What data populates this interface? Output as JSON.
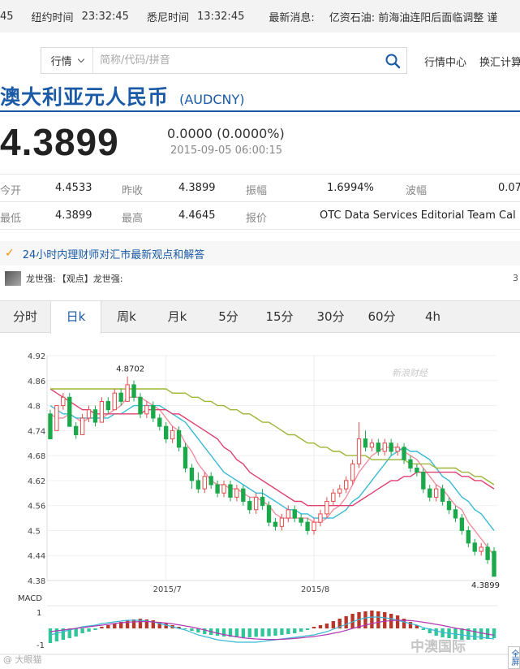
{
  "ticker": {
    "lead": "45",
    "ny_label": "纽约时间",
    "ny_time": "23:32:45",
    "sy_label": "悉尼时间",
    "sy_time": "13:32:45",
    "news_label": "最新消息:",
    "news_text": "亿资石油: 前海油连阳后面临调整 谨"
  },
  "search": {
    "market": "行情",
    "placeholder": "简称/代码/拼音"
  },
  "nav": [
    "行情中心",
    "换汇计算"
  ],
  "header": {
    "title": "澳大利亚元人民币",
    "code": "(AUDCNY)"
  },
  "quote": {
    "price": "4.3899",
    "change": "0.0000 (0.0000%)",
    "time": "2015-09-05 06:00:15",
    "rows": [
      [
        {
          "label": "今开",
          "value": "4.4533"
        },
        {
          "label": "昨收",
          "value": "4.3899"
        },
        {
          "label": "振幅",
          "value": "1.6994%"
        },
        {
          "label": "波幅",
          "value": "0.07"
        }
      ],
      [
        {
          "label": "最低",
          "value": "4.3899"
        },
        {
          "label": "最高",
          "value": "4.4645"
        },
        {
          "label": "报价",
          "value": "OTC Data Services Editorial Team Cal"
        }
      ]
    ]
  },
  "advisor": {
    "headline": "24小时内理财师对汇市最新观点和解答",
    "author": "龙世强:",
    "post": "【观点】龙世强:",
    "count": "3"
  },
  "tabs": [
    "分时",
    "日k",
    "周k",
    "月k",
    "5分",
    "15分",
    "30分",
    "60分",
    "4h"
  ],
  "active_tab": 1,
  "brand_watermark": "新浪财经",
  "watermarks": {
    "left": "@ 大眼猫",
    "right": "中澳国际"
  },
  "fullscreen": "全屏",
  "chart_data": {
    "type": "candlestick",
    "ylim": [
      4.38,
      4.92
    ],
    "yticks": [
      4.92,
      4.86,
      4.8,
      4.74,
      4.68,
      4.62,
      4.56,
      4.5,
      4.44,
      4.38
    ],
    "xticks": [
      {
        "label": "2015/7",
        "index": 18
      },
      {
        "label": "2015/8",
        "index": 41
      }
    ],
    "annotations": [
      {
        "label": "4.8702",
        "index": 12
      },
      {
        "label": "4.3899",
        "index": 69
      }
    ],
    "candles": [
      [
        4.78,
        4.72,
        4.79,
        4.72
      ],
      [
        4.74,
        4.8,
        4.8,
        4.74
      ],
      [
        4.8,
        4.82,
        4.83,
        4.79
      ],
      [
        4.82,
        4.75,
        4.83,
        4.75
      ],
      [
        4.75,
        4.73,
        4.76,
        4.72
      ],
      [
        4.73,
        4.77,
        4.78,
        4.73
      ],
      [
        4.77,
        4.79,
        4.8,
        4.76
      ],
      [
        4.79,
        4.76,
        4.8,
        4.75
      ],
      [
        4.76,
        4.81,
        4.82,
        4.76
      ],
      [
        4.81,
        4.79,
        4.82,
        4.78
      ],
      [
        4.79,
        4.83,
        4.84,
        4.79
      ],
      [
        4.83,
        4.81,
        4.84,
        4.8
      ],
      [
        4.81,
        4.85,
        4.87,
        4.81
      ],
      [
        4.85,
        4.82,
        4.86,
        4.81
      ],
      [
        4.82,
        4.78,
        4.83,
        4.77
      ],
      [
        4.78,
        4.8,
        4.81,
        4.77
      ],
      [
        4.8,
        4.77,
        4.81,
        4.76
      ],
      [
        4.77,
        4.75,
        4.78,
        4.74
      ],
      [
        4.75,
        4.72,
        4.76,
        4.71
      ],
      [
        4.72,
        4.74,
        4.75,
        4.71
      ],
      [
        4.74,
        4.7,
        4.75,
        4.69
      ],
      [
        4.7,
        4.65,
        4.71,
        4.64
      ],
      [
        4.65,
        4.62,
        4.66,
        4.6
      ],
      [
        4.62,
        4.6,
        4.64,
        4.59
      ],
      [
        4.6,
        4.63,
        4.64,
        4.59
      ],
      [
        4.63,
        4.61,
        4.64,
        4.6
      ],
      [
        4.61,
        4.59,
        4.62,
        4.58
      ],
      [
        4.59,
        4.61,
        4.62,
        4.58
      ],
      [
        4.61,
        4.58,
        4.62,
        4.57
      ],
      [
        4.58,
        4.6,
        4.61,
        4.57
      ],
      [
        4.6,
        4.57,
        4.61,
        4.56
      ],
      [
        4.57,
        4.55,
        4.58,
        4.54
      ],
      [
        4.55,
        4.58,
        4.59,
        4.54
      ],
      [
        4.58,
        4.56,
        4.6,
        4.55
      ],
      [
        4.56,
        4.52,
        4.57,
        4.51
      ],
      [
        4.52,
        4.51,
        4.53,
        4.5
      ],
      [
        4.51,
        4.53,
        4.54,
        4.5
      ],
      [
        4.53,
        4.55,
        4.56,
        4.52
      ],
      [
        4.55,
        4.53,
        4.56,
        4.52
      ],
      [
        4.53,
        4.52,
        4.54,
        4.51
      ],
      [
        4.52,
        4.5,
        4.53,
        4.49
      ],
      [
        4.5,
        4.52,
        4.53,
        4.49
      ],
      [
        4.52,
        4.54,
        4.55,
        4.51
      ],
      [
        4.54,
        4.57,
        4.58,
        4.53
      ],
      [
        4.57,
        4.59,
        4.6,
        4.56
      ],
      [
        4.59,
        4.6,
        4.61,
        4.58
      ],
      [
        4.6,
        4.62,
        4.63,
        4.59
      ],
      [
        4.62,
        4.66,
        4.67,
        4.61
      ],
      [
        4.66,
        4.72,
        4.76,
        4.65
      ],
      [
        4.72,
        4.7,
        4.74,
        4.69
      ],
      [
        4.7,
        4.71,
        4.72,
        4.69
      ],
      [
        4.71,
        4.69,
        4.72,
        4.68
      ],
      [
        4.69,
        4.71,
        4.72,
        4.68
      ],
      [
        4.71,
        4.69,
        4.72,
        4.68
      ],
      [
        4.69,
        4.7,
        4.71,
        4.68
      ],
      [
        4.7,
        4.67,
        4.71,
        4.66
      ],
      [
        4.67,
        4.65,
        4.68,
        4.64
      ],
      [
        4.65,
        4.64,
        4.66,
        4.63
      ],
      [
        4.64,
        4.6,
        4.65,
        4.59
      ],
      [
        4.6,
        4.58,
        4.61,
        4.57
      ],
      [
        4.58,
        4.6,
        4.61,
        4.57
      ],
      [
        4.6,
        4.57,
        4.61,
        4.56
      ],
      [
        4.57,
        4.55,
        4.58,
        4.54
      ],
      [
        4.55,
        4.53,
        4.56,
        4.52
      ],
      [
        4.53,
        4.5,
        4.54,
        4.49
      ],
      [
        4.5,
        4.47,
        4.51,
        4.46
      ],
      [
        4.47,
        4.45,
        4.48,
        4.44
      ],
      [
        4.45,
        4.46,
        4.47,
        4.44
      ],
      [
        4.46,
        4.43,
        4.47,
        4.42
      ],
      [
        4.45,
        4.39,
        4.46,
        4.39
      ]
    ],
    "ma": [
      {
        "name": "MA5",
        "color": "#ef8fa0",
        "values": [
          4.78,
          4.77,
          4.77,
          4.78,
          4.77,
          4.76,
          4.77,
          4.77,
          4.77,
          4.78,
          4.79,
          4.8,
          4.82,
          4.82,
          4.82,
          4.81,
          4.8,
          4.79,
          4.77,
          4.75,
          4.74,
          4.71,
          4.69,
          4.66,
          4.64,
          4.62,
          4.61,
          4.61,
          4.6,
          4.6,
          4.59,
          4.58,
          4.58,
          4.57,
          4.56,
          4.54,
          4.53,
          4.53,
          4.53,
          4.53,
          4.53,
          4.52,
          4.52,
          4.53,
          4.55,
          4.56,
          4.58,
          4.61,
          4.64,
          4.66,
          4.68,
          4.69,
          4.7,
          4.7,
          4.7,
          4.69,
          4.68,
          4.67,
          4.65,
          4.63,
          4.61,
          4.6,
          4.58,
          4.56,
          4.55,
          4.52,
          4.5,
          4.48,
          4.46,
          4.44
        ]
      },
      {
        "name": "MA10",
        "color": "#39b9d6",
        "values": [
          4.8,
          4.79,
          4.78,
          4.78,
          4.77,
          4.77,
          4.77,
          4.77,
          4.77,
          4.77,
          4.78,
          4.78,
          4.79,
          4.8,
          4.8,
          4.8,
          4.8,
          4.8,
          4.79,
          4.78,
          4.77,
          4.76,
          4.74,
          4.72,
          4.7,
          4.68,
          4.66,
          4.64,
          4.63,
          4.62,
          4.61,
          4.6,
          4.59,
          4.59,
          4.58,
          4.57,
          4.56,
          4.55,
          4.55,
          4.54,
          4.54,
          4.53,
          4.53,
          4.53,
          4.53,
          4.54,
          4.55,
          4.57,
          4.58,
          4.6,
          4.62,
          4.64,
          4.66,
          4.68,
          4.69,
          4.7,
          4.69,
          4.69,
          4.68,
          4.67,
          4.65,
          4.63,
          4.62,
          4.6,
          4.58,
          4.57,
          4.55,
          4.54,
          4.52,
          4.5
        ]
      },
      {
        "name": "MA20",
        "color": "#de4070",
        "values": [
          4.84,
          4.83,
          4.82,
          4.81,
          4.8,
          4.79,
          4.79,
          4.78,
          4.78,
          4.78,
          4.78,
          4.78,
          4.78,
          4.78,
          4.78,
          4.79,
          4.79,
          4.79,
          4.79,
          4.78,
          4.78,
          4.77,
          4.76,
          4.75,
          4.74,
          4.73,
          4.72,
          4.7,
          4.69,
          4.67,
          4.66,
          4.64,
          4.63,
          4.62,
          4.61,
          4.6,
          4.59,
          4.58,
          4.57,
          4.57,
          4.56,
          4.56,
          4.56,
          4.56,
          4.56,
          4.56,
          4.56,
          4.56,
          4.57,
          4.58,
          4.59,
          4.6,
          4.61,
          4.62,
          4.62,
          4.63,
          4.63,
          4.64,
          4.64,
          4.64,
          4.64,
          4.64,
          4.64,
          4.64,
          4.63,
          4.63,
          4.62,
          4.62,
          4.61,
          4.6
        ]
      },
      {
        "name": "MA60",
        "color": "#9cb637",
        "values": [
          4.84,
          4.84,
          4.84,
          4.84,
          4.84,
          4.84,
          4.84,
          4.84,
          4.84,
          4.84,
          4.84,
          4.84,
          4.84,
          4.84,
          4.84,
          4.84,
          4.84,
          4.84,
          4.84,
          4.83,
          4.83,
          4.83,
          4.82,
          4.82,
          4.81,
          4.81,
          4.8,
          4.8,
          4.79,
          4.79,
          4.78,
          4.78,
          4.77,
          4.76,
          4.76,
          4.75,
          4.74,
          4.73,
          4.73,
          4.72,
          4.71,
          4.71,
          4.7,
          4.7,
          4.69,
          4.69,
          4.68,
          4.68,
          4.68,
          4.68,
          4.67,
          4.67,
          4.67,
          4.67,
          4.67,
          4.67,
          4.66,
          4.66,
          4.66,
          4.66,
          4.65,
          4.65,
          4.65,
          4.65,
          4.64,
          4.64,
          4.63,
          4.63,
          4.62,
          4.61
        ]
      }
    ],
    "macd": {
      "label": "MACD",
      "yticks": [
        1,
        -1
      ],
      "hist": [
        -0.9,
        -0.8,
        -0.7,
        -0.6,
        -0.5,
        -0.3,
        -0.2,
        -0.1,
        0.1,
        0.2,
        0.3,
        0.4,
        0.5,
        0.55,
        0.6,
        0.55,
        0.5,
        0.4,
        0.3,
        0.2,
        0.1,
        -0.05,
        -0.15,
        -0.25,
        -0.35,
        -0.4,
        -0.45,
        -0.5,
        -0.52,
        -0.55,
        -0.55,
        -0.55,
        -0.52,
        -0.5,
        -0.48,
        -0.45,
        -0.4,
        -0.35,
        -0.3,
        -0.2,
        -0.1,
        0.1,
        0.2,
        0.3,
        0.45,
        0.6,
        0.75,
        0.9,
        1.0,
        1.05,
        1.1,
        1.05,
        1.0,
        0.9,
        0.8,
        0.6,
        0.4,
        0.2,
        -0.1,
        -0.3,
        -0.45,
        -0.55,
        -0.6,
        -0.65,
        -0.7,
        -0.7,
        -0.7,
        -0.68,
        -0.65,
        -0.6
      ],
      "dif": [
        -0.4,
        -0.3,
        -0.2,
        -0.1,
        0.0,
        0.1,
        0.15,
        0.2,
        0.3,
        0.35,
        0.4,
        0.45,
        0.5,
        0.5,
        0.5,
        0.45,
        0.4,
        0.3,
        0.2,
        0.1,
        0.0,
        -0.1,
        -0.25,
        -0.4,
        -0.5,
        -0.6,
        -0.7,
        -0.75,
        -0.8,
        -0.85,
        -0.85,
        -0.85,
        -0.85,
        -0.8,
        -0.75,
        -0.7,
        -0.65,
        -0.6,
        -0.55,
        -0.5,
        -0.45,
        -0.4,
        -0.3,
        -0.2,
        -0.05,
        0.1,
        0.25,
        0.4,
        0.55,
        0.65,
        0.7,
        0.7,
        0.65,
        0.6,
        0.5,
        0.4,
        0.3,
        0.2,
        0.05,
        -0.05,
        -0.15,
        -0.25,
        -0.3,
        -0.35,
        -0.4,
        -0.45,
        -0.5,
        -0.55,
        -0.6,
        -0.65
      ],
      "dea": [
        -0.2,
        -0.15,
        -0.1,
        -0.05,
        0.0,
        0.05,
        0.1,
        0.15,
        0.2,
        0.25,
        0.3,
        0.35,
        0.38,
        0.4,
        0.42,
        0.42,
        0.4,
        0.37,
        0.33,
        0.28,
        0.22,
        0.15,
        0.08,
        0.0,
        -0.1,
        -0.2,
        -0.3,
        -0.38,
        -0.45,
        -0.52,
        -0.58,
        -0.62,
        -0.65,
        -0.67,
        -0.68,
        -0.68,
        -0.67,
        -0.65,
        -0.62,
        -0.58,
        -0.54,
        -0.5,
        -0.44,
        -0.38,
        -0.3,
        -0.22,
        -0.12,
        0.0,
        0.1,
        0.2,
        0.3,
        0.38,
        0.44,
        0.48,
        0.5,
        0.5,
        0.48,
        0.44,
        0.38,
        0.32,
        0.25,
        0.18,
        0.1,
        0.02,
        -0.05,
        -0.12,
        -0.2,
        -0.28,
        -0.35,
        -0.42
      ]
    }
  }
}
